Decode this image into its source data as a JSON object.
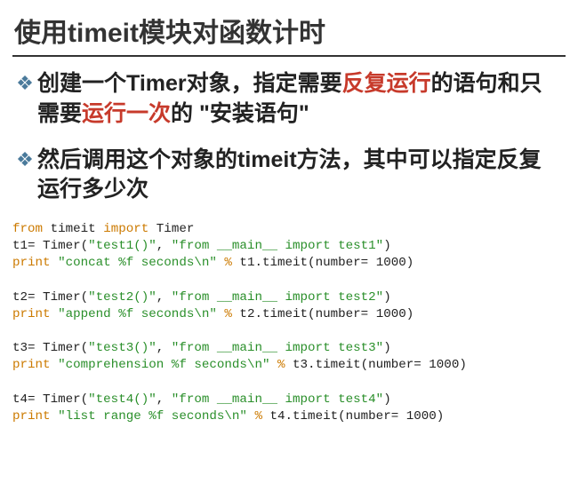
{
  "title": "使用timeit模块对函数计时",
  "bullets": [
    {
      "pre1": "创建一个Timer对象，指定需要",
      "kw1": "反复运行",
      "mid": "的语句和只需要",
      "kw2": "运行一次",
      "post": "的 \"安装语句\""
    },
    {
      "text": "然后调用这个对象的timeit方法，其中可以指定反复运行多少次"
    }
  ],
  "code": {
    "l01a": "from",
    "l01b": " timeit ",
    "l01c": "import",
    "l01d": " Timer",
    "l02a": "t1= Timer(",
    "l02b": "\"test1()\"",
    "l02c": ", ",
    "l02d": "\"from __main__ import test1\"",
    "l02e": ")",
    "l03a": "print",
    "l03b": " \"concat %f seconds\\n\" ",
    "l03c": "%",
    "l03d": " t1.timeit(number= ",
    "l03e": "1000",
    "l03f": ")",
    "blank": " ",
    "l05a": "t2= Timer(",
    "l05b": "\"test2()\"",
    "l05c": ", ",
    "l05d": "\"from __main__ import test2\"",
    "l05e": ")",
    "l06a": "print",
    "l06b": " \"append %f seconds\\n\" ",
    "l06c": "%",
    "l06d": " t2.timeit(number= ",
    "l06e": "1000",
    "l06f": ")",
    "l08a": "t3= Timer(",
    "l08b": "\"test3()\"",
    "l08c": ", ",
    "l08d": "\"from __main__ import test3\"",
    "l08e": ")",
    "l09a": "print",
    "l09b": " \"comprehension %f seconds\\n\" ",
    "l09c": "%",
    "l09d": " t3.timeit(number= ",
    "l09e": "1000",
    "l09f": ")",
    "l11a": "t4= Timer(",
    "l11b": "\"test4()\"",
    "l11c": ", ",
    "l11d": "\"from __main__ import test4\"",
    "l11e": ")",
    "l12a": "print",
    "l12b": " \"list range %f seconds\\n\" ",
    "l12c": "%",
    "l12d": " t4.timeit(number= ",
    "l12e": "1000",
    "l12f": ")"
  }
}
